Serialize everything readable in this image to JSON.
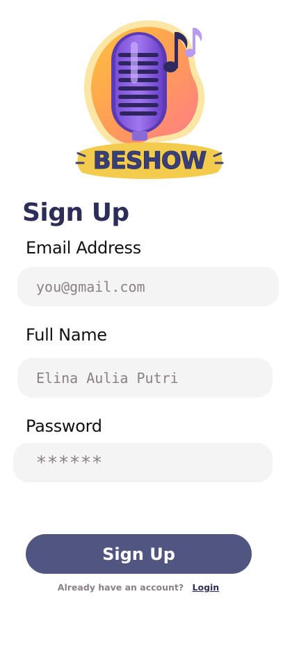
{
  "logo": {
    "brand": "BESHOW"
  },
  "page": {
    "title": "Sign Up"
  },
  "form": {
    "email": {
      "label": "Email Address",
      "placeholder": "you@gmail.com"
    },
    "full_name": {
      "label": "Full Name",
      "placeholder": "Elina Aulia Putri"
    },
    "password": {
      "label": "Password",
      "masked_value": "******"
    }
  },
  "actions": {
    "signup_label": "Sign Up"
  },
  "footer": {
    "question": "Already have an account?",
    "login_link": "Login"
  },
  "colors": {
    "primary_button": "#515681",
    "title": "#2d2d5a",
    "field_bg": "#f4f4f4",
    "placeholder": "#8a8086"
  }
}
